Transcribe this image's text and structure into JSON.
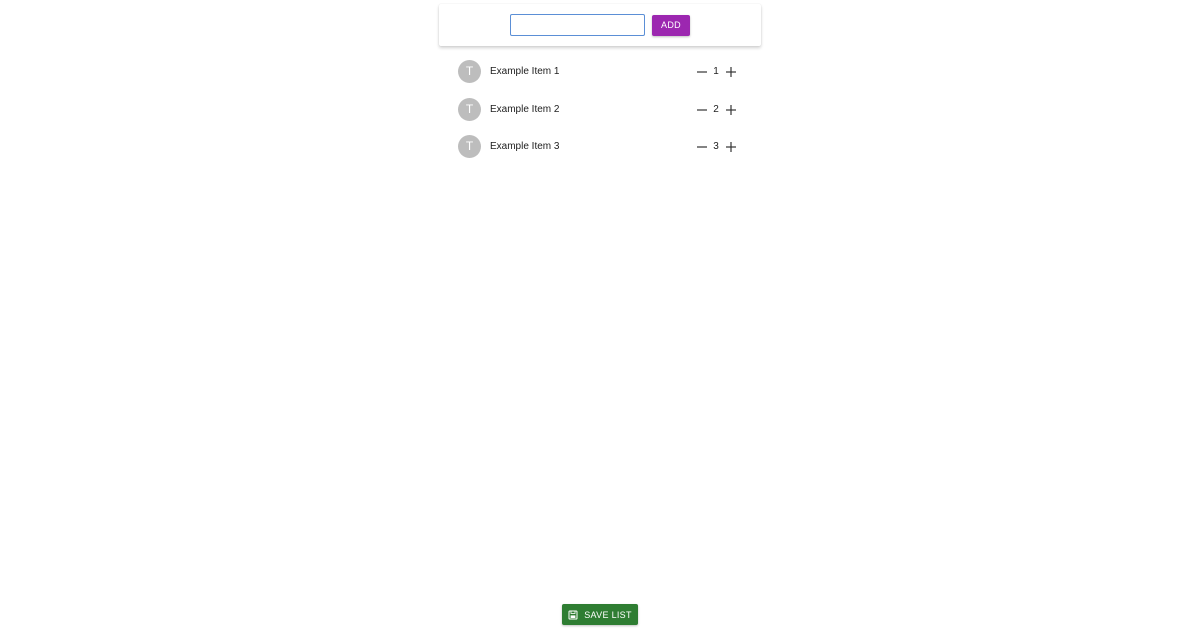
{
  "add_form": {
    "input_value": "",
    "input_placeholder": "",
    "add_label": "ADD"
  },
  "items": [
    {
      "avatar_letter": "T",
      "label": "Example Item 1",
      "quantity": "1"
    },
    {
      "avatar_letter": "T",
      "label": "Example Item 2",
      "quantity": "2"
    },
    {
      "avatar_letter": "T",
      "label": "Example Item 3",
      "quantity": "3"
    }
  ],
  "footer": {
    "save_label": "SAVE LIST",
    "save_icon": "save-icon"
  },
  "colors": {
    "add_button": "#9c27b0",
    "save_button": "#2e7d32",
    "avatar": "#bdbdbd",
    "input_border": "#5b8fd6"
  },
  "icons": {
    "decrement": "minus-icon",
    "increment": "plus-icon"
  }
}
